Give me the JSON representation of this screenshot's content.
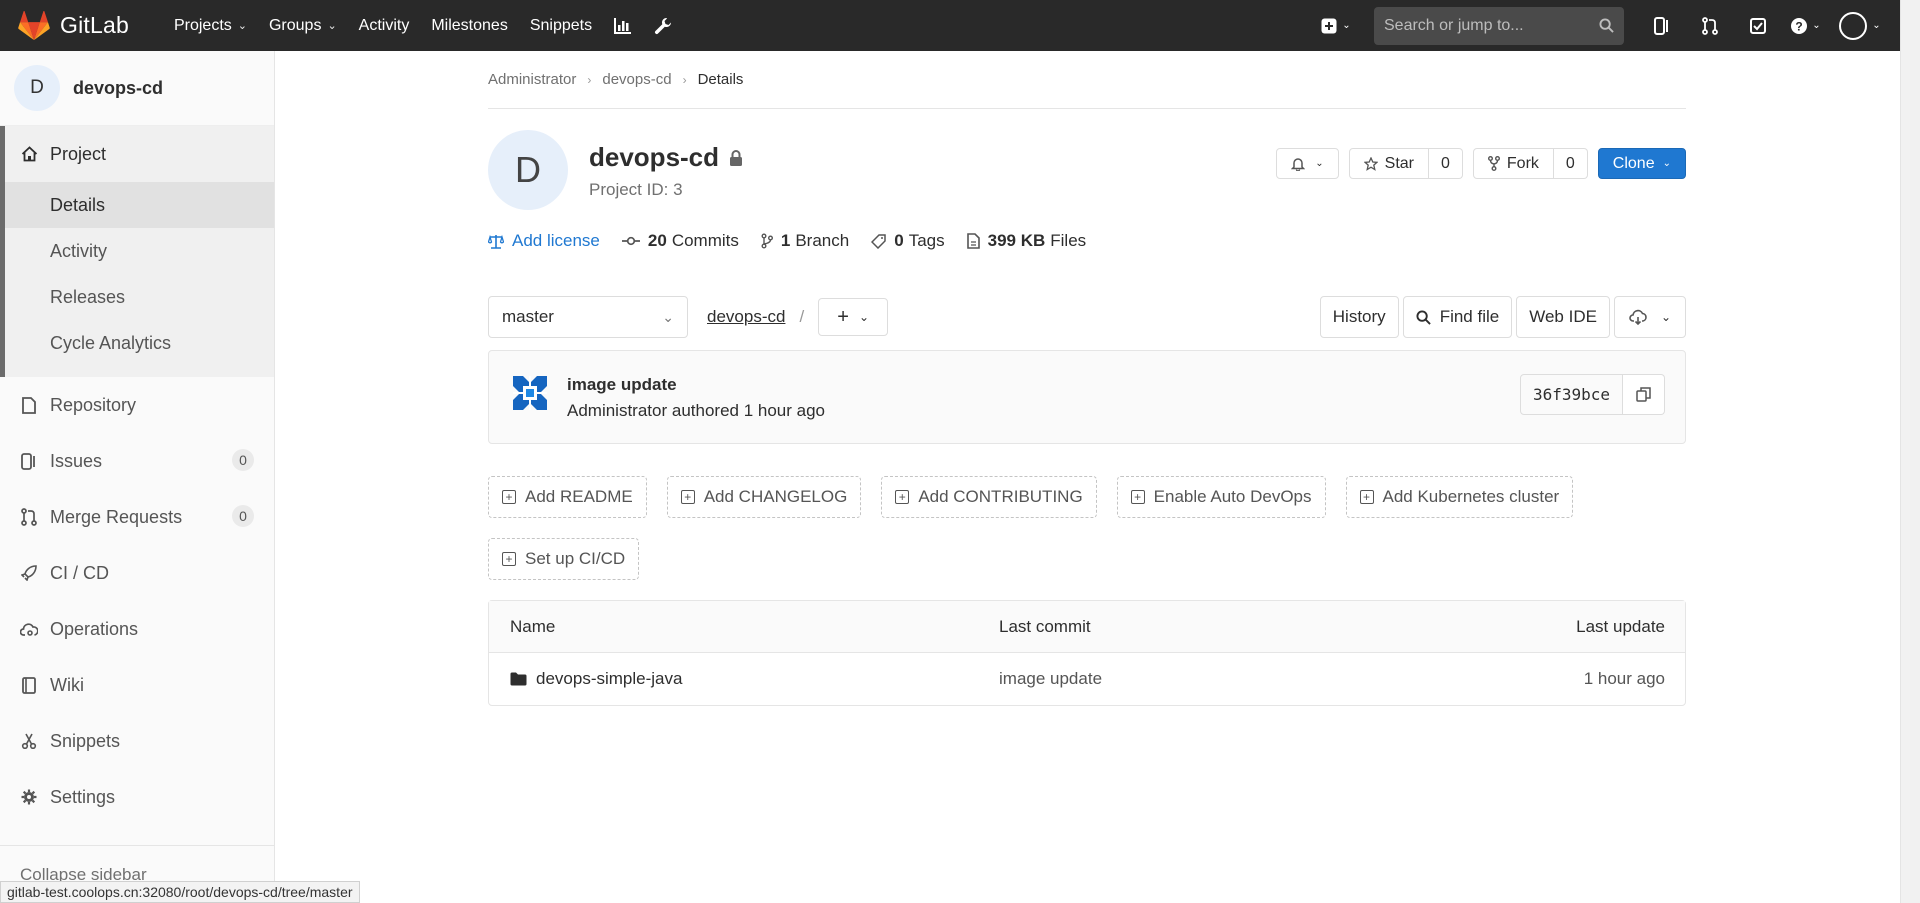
{
  "navbar": {
    "brand": "GitLab",
    "links": [
      {
        "label": "Projects",
        "dropdown": true
      },
      {
        "label": "Groups",
        "dropdown": true
      },
      {
        "label": "Activity",
        "dropdown": false
      },
      {
        "label": "Milestones",
        "dropdown": false
      },
      {
        "label": "Snippets",
        "dropdown": false
      }
    ],
    "search_placeholder": "Search or jump to..."
  },
  "sidebar": {
    "project_initial": "D",
    "project_name": "devops-cd",
    "project_section": "Project",
    "project_subitems": [
      "Details",
      "Activity",
      "Releases",
      "Cycle Analytics"
    ],
    "items": [
      {
        "label": "Repository",
        "icon": "doc-icon"
      },
      {
        "label": "Issues",
        "icon": "issues-icon",
        "count": "0"
      },
      {
        "label": "Merge Requests",
        "icon": "merge-request-icon",
        "count": "0"
      },
      {
        "label": "CI / CD",
        "icon": "rocket-icon"
      },
      {
        "label": "Operations",
        "icon": "cloud-gear-icon"
      },
      {
        "label": "Wiki",
        "icon": "book-icon"
      },
      {
        "label": "Snippets",
        "icon": "scissors-icon"
      },
      {
        "label": "Settings",
        "icon": "gear-icon"
      }
    ],
    "collapse_label": "Collapse sidebar"
  },
  "statusbar": "gitlab-test.coolops.cn:32080/root/devops-cd/tree/master",
  "breadcrumb": [
    "Administrator",
    "devops-cd",
    "Details"
  ],
  "project": {
    "initial": "D",
    "name": "devops-cd",
    "id_label": "Project ID: 3",
    "star_label": "Star",
    "star_count": "0",
    "fork_label": "Fork",
    "fork_count": "0",
    "clone_label": "Clone"
  },
  "stats": {
    "license": "Add license",
    "commits_num": "20",
    "commits_label": "Commits",
    "branch_num": "1",
    "branch_label": "Branch",
    "tags_num": "0",
    "tags_label": "Tags",
    "files_num": "399 KB",
    "files_label": "Files"
  },
  "tree": {
    "branch": "master",
    "path": "devops-cd",
    "path_sep": "/",
    "buttons": [
      "History",
      "Find file",
      "Web IDE"
    ]
  },
  "last_commit": {
    "title": "image update",
    "meta": "Administrator authored 1 hour ago",
    "sha": "36f39bce"
  },
  "suggestions": [
    "Add README",
    "Add CHANGELOG",
    "Add CONTRIBUTING",
    "Enable Auto DevOps",
    "Add Kubernetes cluster",
    "Set up CI/CD"
  ],
  "files": {
    "headers": [
      "Name",
      "Last commit",
      "Last update"
    ],
    "rows": [
      {
        "name": "devops-simple-java",
        "commit": "image update",
        "update": "1 hour ago"
      }
    ]
  },
  "colors": {
    "navbar": "#292929",
    "primary": "#1f78d1",
    "link": "#1f78d1"
  }
}
